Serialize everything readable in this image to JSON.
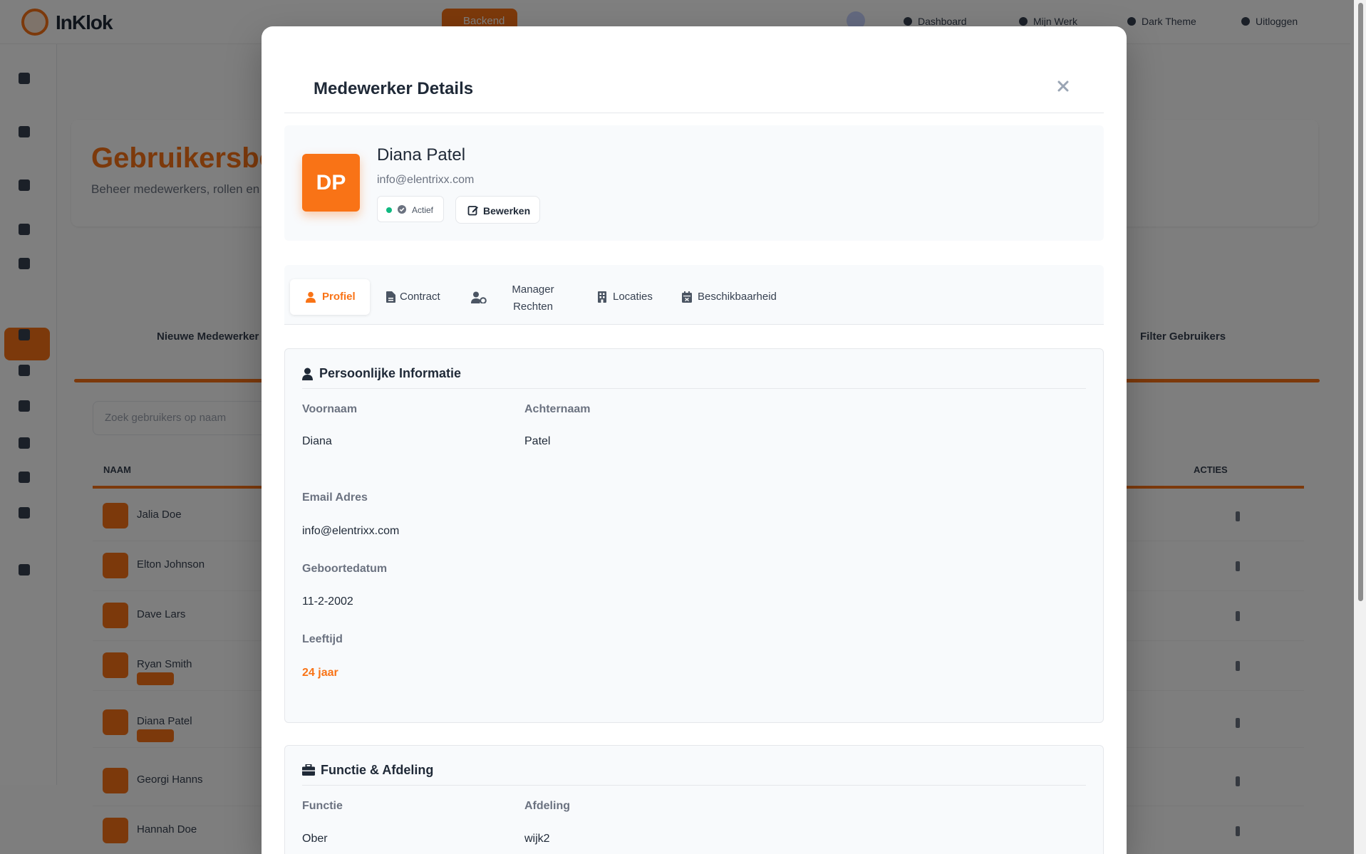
{
  "background": {
    "logo_text": "InKlok",
    "top_cta": "Backend",
    "top_links": [
      "Dashboard",
      "Mijn Werk",
      "Dark Theme",
      "Uitloggen"
    ],
    "page_title": "Gebruikersbeheer",
    "page_subtitle": "Beheer medewerkers, rollen en rechten",
    "new_button": "Nieuwe Medewerker",
    "filter_button": "Filter Gebruikers",
    "search_placeholder": "Zoek gebruikers op naam",
    "col_name": "NAAM",
    "col_actions": "ACTIES",
    "rows": [
      "Jalia Doe",
      "Elton Johnson",
      "Dave Lars",
      "Ryan Smith",
      "Diana Patel",
      "Georgi Hanns",
      "Hannah Doe"
    ]
  },
  "modal": {
    "title": "Medewerker Details",
    "close_icon": "close-icon",
    "profile": {
      "initials": "DP",
      "name": "Diana Patel",
      "email": "info@elentrixx.com",
      "status": "Actief",
      "status_color": "#10b981",
      "edit_label": "Bewerken"
    },
    "tabs": [
      {
        "label": "Profiel",
        "icon": "user-icon",
        "active": true
      },
      {
        "label": "Contract",
        "icon": "file-icon",
        "active": false
      },
      {
        "label": "Manager Rechten",
        "icon": "user-cog-icon",
        "active": false
      },
      {
        "label": "Locaties",
        "icon": "building-icon",
        "active": false
      },
      {
        "label": "Beschikbaarheid",
        "icon": "calendar-icon",
        "active": false
      }
    ],
    "personal": {
      "title": "Persoonlijke Informatie",
      "first_name_label": "Voornaam",
      "first_name": "Diana",
      "last_name_label": "Achternaam",
      "last_name": "Patel",
      "email_label": "Email Adres",
      "email": "info@elentrixx.com",
      "birthdate_label": "Geboortedatum",
      "birthdate": "11-2-2002",
      "age_label": "Leeftijd",
      "age": "24 jaar"
    },
    "job": {
      "title": "Functie & Afdeling",
      "function_label": "Functie",
      "function": "Ober",
      "department_label": "Afdeling",
      "department": "wijk2"
    }
  },
  "colors": {
    "accent": "#f97316",
    "overlay": "rgba(0,0,0,0.5)"
  }
}
